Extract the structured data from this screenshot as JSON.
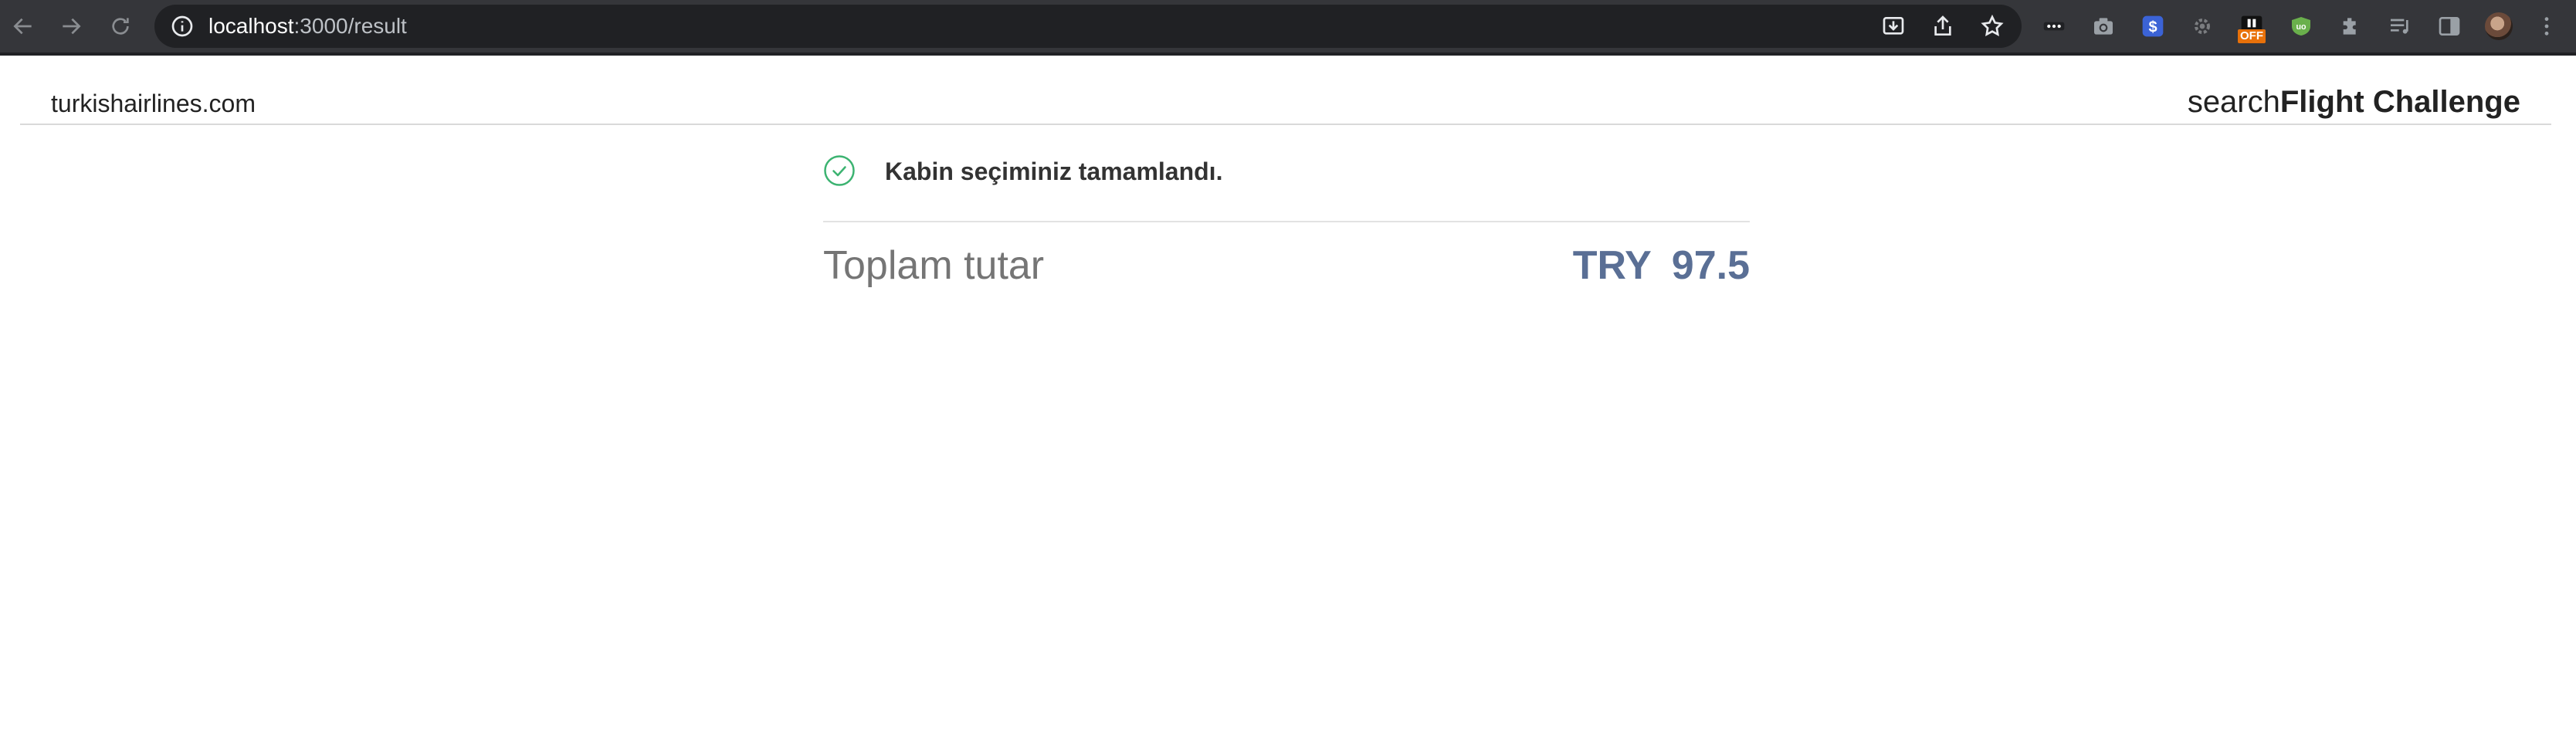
{
  "browser": {
    "url_host": "localhost",
    "url_path": ":3000/result",
    "extensions": [
      {
        "icon": "dots-extension-icon"
      },
      {
        "icon": "camera-extension-icon"
      },
      {
        "icon": "dollar-extension-icon"
      },
      {
        "icon": "gear-extension-icon"
      },
      {
        "icon": "pause-extension-icon",
        "badge": "OFF"
      },
      {
        "icon": "ublock-extension-icon"
      },
      {
        "icon": "puzzle-extensions-icon"
      },
      {
        "icon": "media-queue-icon"
      },
      {
        "icon": "side-panel-icon"
      }
    ]
  },
  "header": {
    "site": "turkishairlines.com",
    "brand_prefix": "search",
    "brand_bold": "Flight Challenge"
  },
  "result": {
    "message": "Kabin seçiminiz tamamlandı.",
    "total_label": "Toplam tutar",
    "currency": "TRY",
    "amount": "97.5"
  },
  "colors": {
    "success": "#3cb371",
    "amount": "#5a6f95",
    "chrome_bg": "#35363a"
  }
}
